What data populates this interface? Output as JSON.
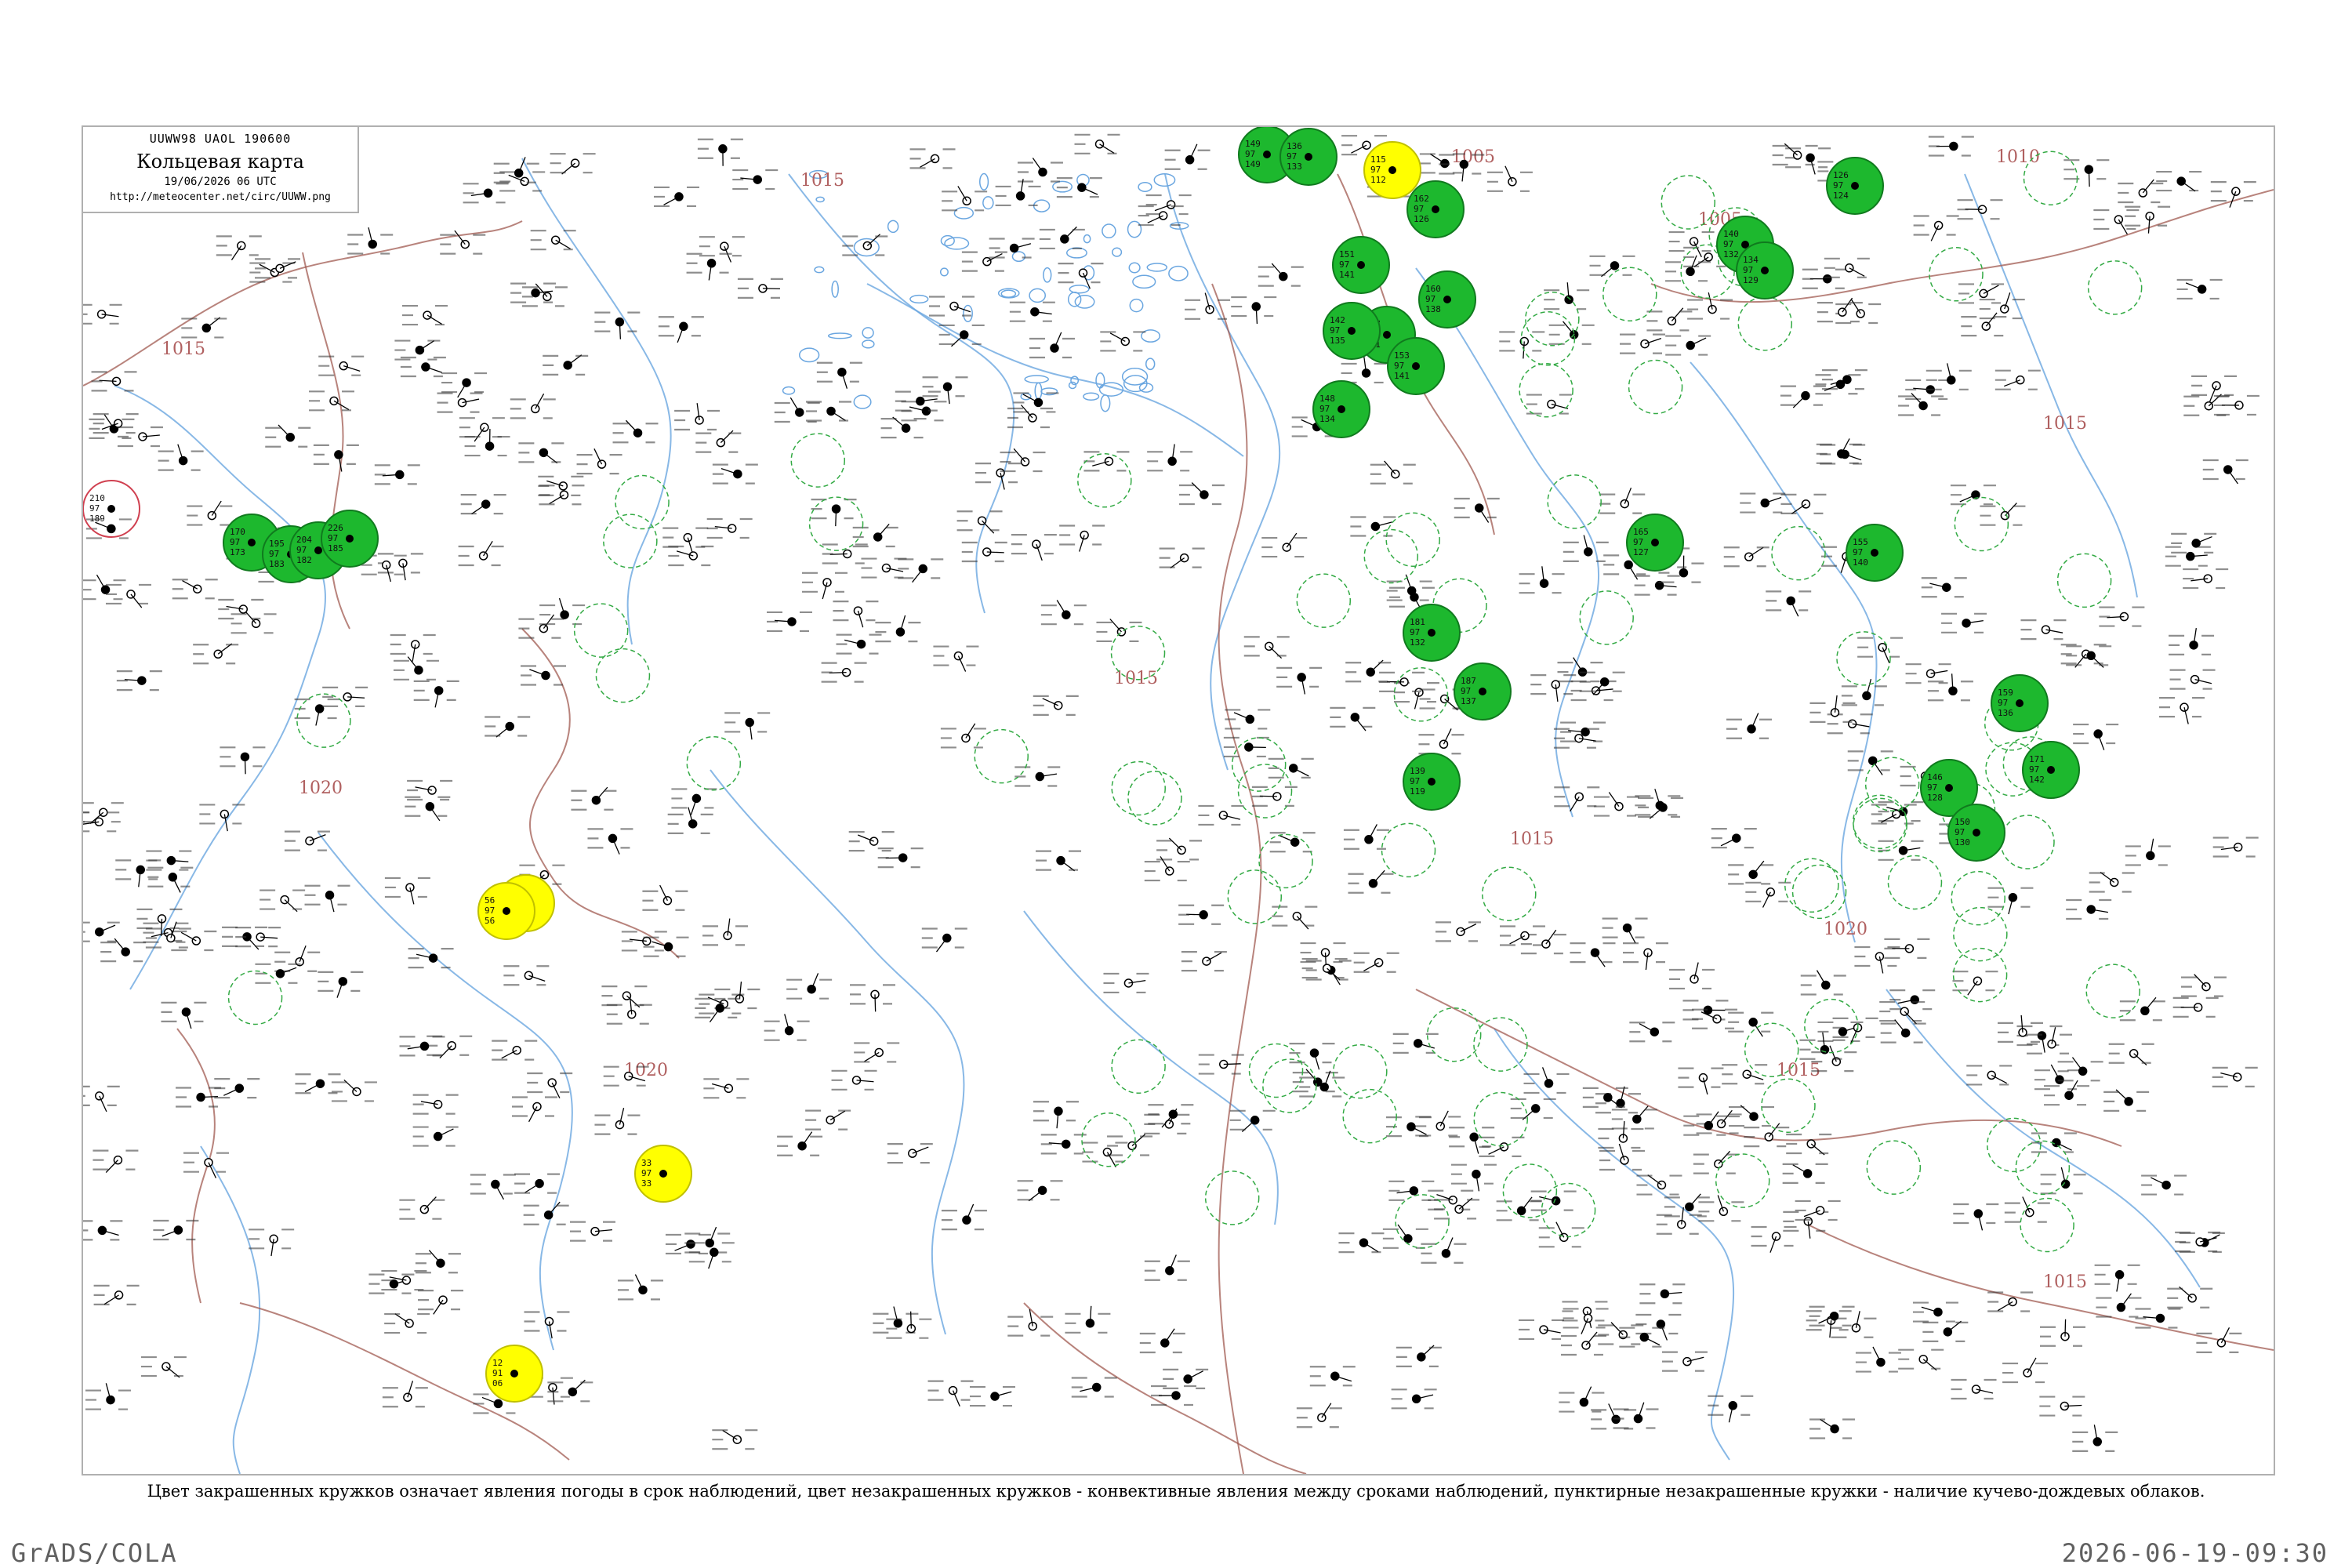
{
  "header": {
    "code_line": "UUWW98 UAOL 190600",
    "title": "Кольцевая карта",
    "timestamp": "19/06/2026 06 UTC",
    "url": "http://meteocenter.net/circ/UUWW.png"
  },
  "caption": "Цвет закрашенных кружков означает явления погоды в срок наблюдений, цвет незакрашенных кружков - конвективные явления между сроками наблюдений, пунктирные незакрашенные кружки - наличие кучево-дождевых облаков.",
  "footer": {
    "left": "GrADS/COLA",
    "right": "2026-06-19-09:30"
  },
  "isobars": [
    {
      "label": "1015"
    },
    {
      "label": "1015"
    },
    {
      "label": "1020"
    },
    {
      "label": "1020"
    },
    {
      "label": "1015"
    },
    {
      "label": "1005"
    },
    {
      "label": "1005"
    },
    {
      "label": "1010"
    },
    {
      "label": "1015"
    },
    {
      "label": "1015"
    },
    {
      "label": "1015"
    },
    {
      "label": "1020"
    },
    {
      "label": "1015"
    }
  ],
  "colors": {
    "green_fill": "#1db82e",
    "yellow_fill": "#ffff00",
    "green_outline": "#33aa44",
    "red_outline": "#d04050",
    "isobar": "#a05a50",
    "river": "#6aa6e0",
    "frame": "#b0b0b0"
  },
  "stations": [
    {
      "t": "170",
      "p": "97",
      "d": "173",
      "kind": "green"
    },
    {
      "t": "195",
      "p": "97",
      "d": "183",
      "kind": "green"
    },
    {
      "t": "204",
      "p": "97",
      "d": "182",
      "kind": "green"
    },
    {
      "t": "226",
      "p": "97",
      "d": "185",
      "kind": "green"
    },
    {
      "t": "210",
      "p": "97",
      "d": "189",
      "kind": "red-outline"
    },
    {
      "t": "154",
      "p": "97",
      "d": "127",
      "kind": "yellow"
    },
    {
      "t": "56",
      "p": "97",
      "d": "56",
      "kind": "yellow"
    },
    {
      "t": "33",
      "p": "97",
      "d": "33",
      "kind": "yellow"
    },
    {
      "t": "12",
      "p": "91",
      "d": "06",
      "kind": "yellow"
    },
    {
      "t": "115",
      "p": "97",
      "d": "112",
      "kind": "yellow"
    },
    {
      "t": "126",
      "p": "97",
      "d": "124",
      "kind": "green"
    },
    {
      "t": "149",
      "p": "97",
      "d": "149",
      "kind": "green"
    },
    {
      "t": "136",
      "p": "97",
      "d": "133",
      "kind": "green"
    },
    {
      "t": "162",
      "p": "97",
      "d": "126",
      "kind": "green"
    },
    {
      "t": "151",
      "p": "97",
      "d": "141",
      "kind": "green"
    },
    {
      "t": "160",
      "p": "97",
      "d": "138",
      "kind": "green"
    },
    {
      "t": "157",
      "p": "97",
      "d": "141",
      "kind": "green"
    },
    {
      "t": "142",
      "p": "97",
      "d": "135",
      "kind": "green"
    },
    {
      "t": "153",
      "p": "97",
      "d": "141",
      "kind": "green"
    },
    {
      "t": "148",
      "p": "97",
      "d": "134",
      "kind": "green"
    },
    {
      "t": "181",
      "p": "97",
      "d": "132",
      "kind": "green"
    },
    {
      "t": "187",
      "p": "97",
      "d": "137",
      "kind": "green"
    },
    {
      "t": "139",
      "p": "97",
      "d": "119",
      "kind": "green"
    },
    {
      "t": "165",
      "p": "97",
      "d": "127",
      "kind": "green"
    },
    {
      "t": "140",
      "p": "97",
      "d": "132",
      "kind": "green"
    },
    {
      "t": "134",
      "p": "97",
      "d": "129",
      "kind": "green"
    },
    {
      "t": "155",
      "p": "97",
      "d": "140",
      "kind": "green"
    },
    {
      "t": "146",
      "p": "97",
      "d": "128",
      "kind": "green"
    },
    {
      "t": "159",
      "p": "97",
      "d": "136",
      "kind": "green"
    },
    {
      "t": "171",
      "p": "97",
      "d": "142",
      "kind": "green"
    },
    {
      "t": "150",
      "p": "97",
      "d": "130",
      "kind": "green"
    }
  ]
}
